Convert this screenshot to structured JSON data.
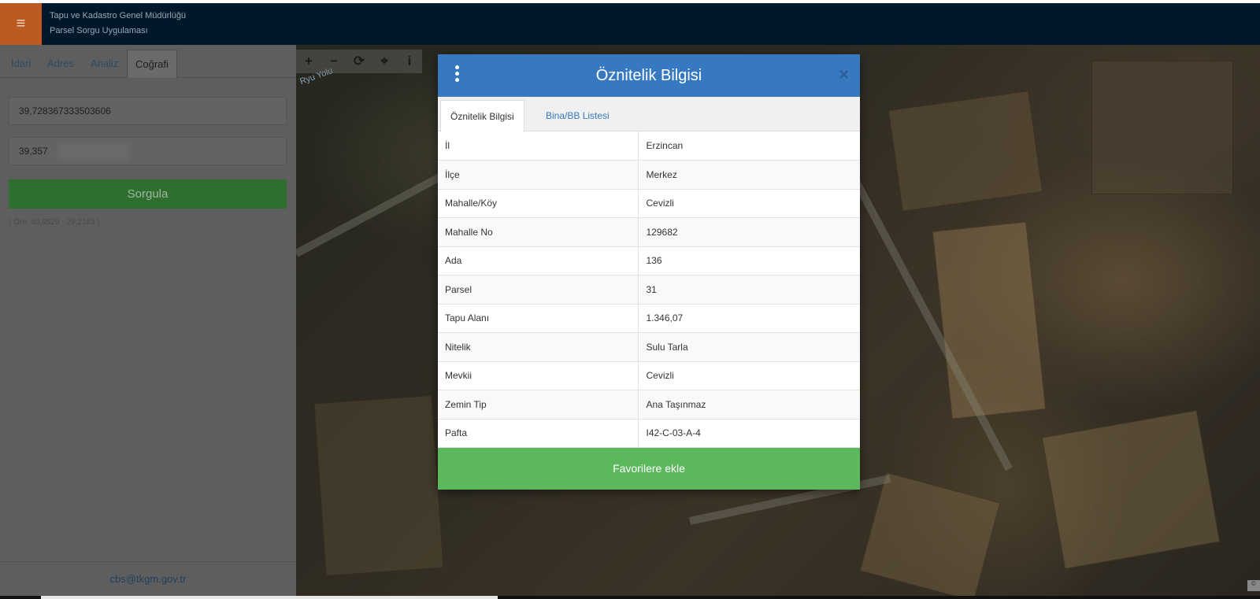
{
  "header": {
    "org_name": "Tapu ve Kadastro Genel Müdürlüğü",
    "app_name": "Parsel Sorgu Uygulaması",
    "menu_icon": "hamburger-icon"
  },
  "sidebar": {
    "tabs": [
      {
        "label": "İdari",
        "active": false
      },
      {
        "label": "Adres",
        "active": false
      },
      {
        "label": "Analiz",
        "active": false
      },
      {
        "label": "Coğrafi",
        "active": true
      }
    ],
    "latitude_value": "39,728367333503606",
    "longitude_value": "39,357",
    "query_button": "Sorgula",
    "hint": "( Örn: 40,9529 - 29,2163 )",
    "footer_email": "cbs@tkgm.gov.tr"
  },
  "map": {
    "road_label": "Ryu Yolu",
    "tools": [
      {
        "symbol": "+",
        "icon": "zoom-in-icon"
      },
      {
        "symbol": "−",
        "icon": "zoom-out-icon"
      },
      {
        "symbol": "⟳",
        "icon": "refresh-icon"
      },
      {
        "symbol": "⌖",
        "icon": "locate-icon"
      },
      {
        "symbol": "i",
        "icon": "info-icon"
      }
    ],
    "credit": "©"
  },
  "modal": {
    "title": "Öznitelik Bilgisi",
    "close": "×",
    "tabs": [
      {
        "label": "Öznitelik Bilgisi",
        "active": true
      },
      {
        "label": "Bina/BB Listesi",
        "active": false
      }
    ],
    "rows": [
      {
        "key": "İl",
        "value": "Erzincan"
      },
      {
        "key": "İlçe",
        "value": "Merkez"
      },
      {
        "key": "Mahalle/Köy",
        "value": "Cevizli"
      },
      {
        "key": "Mahalle No",
        "value": "129682"
      },
      {
        "key": "Ada",
        "value": "136"
      },
      {
        "key": "Parsel",
        "value": "31"
      },
      {
        "key": "Tapu Alanı",
        "value": "1.346,07"
      },
      {
        "key": "Nitelik",
        "value": "Sulu Tarla"
      },
      {
        "key": "Mevkii",
        "value": "Cevizli"
      },
      {
        "key": "Zemin Tip",
        "value": "Ana Taşınmaz"
      },
      {
        "key": "Pafta",
        "value": "I42-C-03-A-4"
      }
    ],
    "favorite_button": "Favorilere ekle"
  },
  "colors": {
    "header_bg": "#01182b",
    "menu_button": "#bd5a21",
    "modal_header": "#3779c0",
    "favorite_button": "#5cb85c"
  }
}
